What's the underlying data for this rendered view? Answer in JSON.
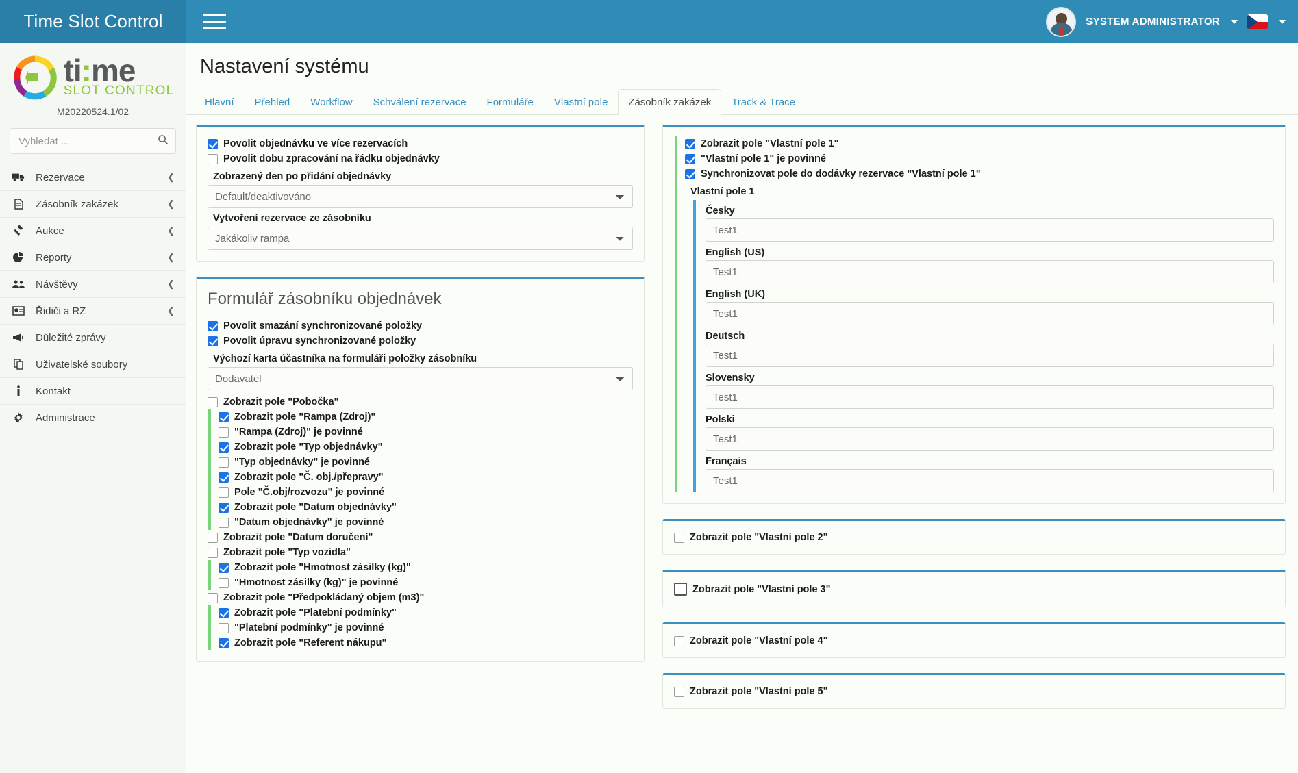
{
  "topbar": {
    "brand": "Time Slot Control",
    "menu_icon": "hamburger-icon",
    "user_name": "SYSTEM ADMINISTRATOR",
    "language_flag": "czech-flag"
  },
  "sidebar": {
    "logo_main": "ti",
    "logo_colon": ":",
    "logo_end": "me",
    "logo_sub": "SLOT CONTROL",
    "version": "M20220524.1/02",
    "search_placeholder": "Vyhledat ...",
    "items": [
      {
        "label": "Rezervace",
        "icon": "truck-icon"
      },
      {
        "label": "Zásobník zakázek",
        "icon": "clipboard-icon"
      },
      {
        "label": "Aukce",
        "icon": "gavel-icon"
      },
      {
        "label": "Reporty",
        "icon": "pie-chart-icon"
      },
      {
        "label": "Návštěvy",
        "icon": "users-icon"
      },
      {
        "label": "Řidiči a RZ",
        "icon": "id-card-icon"
      },
      {
        "label": "Důležité zprávy",
        "icon": "megaphone-icon"
      },
      {
        "label": "Uživatelské soubory",
        "icon": "copy-icon"
      },
      {
        "label": "Kontakt",
        "icon": "info-icon"
      },
      {
        "label": "Administrace",
        "icon": "gear-icon"
      }
    ]
  },
  "page": {
    "title": "Nastavení systému",
    "tabs": [
      {
        "label": "Hlavní",
        "active": false
      },
      {
        "label": "Přehled",
        "active": false
      },
      {
        "label": "Workflow",
        "active": false
      },
      {
        "label": "Schválení rezervace",
        "active": false
      },
      {
        "label": "Formuláře",
        "active": false
      },
      {
        "label": "Vlastní pole",
        "active": false
      },
      {
        "label": "Zásobník zakázek",
        "active": true
      },
      {
        "label": "Track & Trace",
        "active": false
      }
    ]
  },
  "left_card_1": {
    "checkboxes": [
      {
        "label": "Povolit objednávku ve více rezervacích",
        "checked": true
      },
      {
        "label": "Povolit dobu zpracování na řádku objednávky",
        "checked": false
      }
    ],
    "field1_label": "Zobrazený den po přidání objednávky",
    "field1_value": "Default/deaktivováno",
    "field2_label": "Vytvoření rezervace ze zásobníku",
    "field2_value": "Jakákoliv rampa"
  },
  "left_card_2": {
    "title": "Formulář zásobníku objednávek",
    "checkboxes_top": [
      {
        "label": "Povolit smazání synchronizované položky",
        "checked": true
      },
      {
        "label": "Povolit úpravu synchronizované položky",
        "checked": true
      }
    ],
    "field_label": "Výchozí karta účastníka na formuláři položky zásobníku",
    "field_value": "Dodavatel",
    "field_list": [
      {
        "label": "Zobrazit pole \"Pobočka\"",
        "checked": false,
        "indent": false
      },
      {
        "label": "Zobrazit pole \"Rampa (Zdroj)\"",
        "checked": true,
        "indent": true
      },
      {
        "label": "\"Rampa (Zdroj)\" je povinné",
        "checked": false,
        "indent": true
      },
      {
        "label": "Zobrazit pole \"Typ objednávky\"",
        "checked": true,
        "indent": true
      },
      {
        "label": "\"Typ objednávky\" je povinné",
        "checked": false,
        "indent": true
      },
      {
        "label": "Zobrazit pole \"Č. obj./přepravy\"",
        "checked": true,
        "indent": true
      },
      {
        "label": "Pole \"Č.obj/rozvozu\" je povinné",
        "checked": false,
        "indent": true
      },
      {
        "label": "Zobrazit pole \"Datum objednávky\"",
        "checked": true,
        "indent": true
      },
      {
        "label": "\"Datum objednávky\" je povinné",
        "checked": false,
        "indent": true
      },
      {
        "label": "Zobrazit pole \"Datum doručení\"",
        "checked": false,
        "indent": false
      },
      {
        "label": "Zobrazit pole \"Typ vozidla\"",
        "checked": false,
        "indent": false
      },
      {
        "label": "Zobrazit pole \"Hmotnost zásilky (kg)\"",
        "checked": true,
        "indent": true
      },
      {
        "label": "\"Hmotnost zásilky (kg)\" je povinné",
        "checked": false,
        "indent": true
      },
      {
        "label": "Zobrazit pole \"Předpokládaný objem (m3)\"",
        "checked": false,
        "indent": false
      },
      {
        "label": "Zobrazit pole \"Platební podmínky\"",
        "checked": true,
        "indent": true
      },
      {
        "label": "\"Platební podmínky\" je povinné",
        "checked": false,
        "indent": true
      },
      {
        "label": "Zobrazit pole \"Referent nákupu\"",
        "checked": true,
        "indent": true
      }
    ]
  },
  "right_card_1": {
    "checkboxes": [
      {
        "label": "Zobrazit pole \"Vlastní pole 1\"",
        "checked": true
      },
      {
        "label": "\"Vlastní pole 1\" je povinné",
        "checked": true
      },
      {
        "label": "Synchronizovat pole do dodávky rezervace \"Vlastní pole 1\"",
        "checked": true
      }
    ],
    "group_label": "Vlastní pole 1",
    "languages": [
      {
        "label": "Česky",
        "value": "Test1"
      },
      {
        "label": "English (US)",
        "value": "Test1"
      },
      {
        "label": "English (UK)",
        "value": "Test1"
      },
      {
        "label": "Deutsch",
        "value": "Test1"
      },
      {
        "label": "Slovensky",
        "value": "Test1"
      },
      {
        "label": "Polski",
        "value": "Test1"
      },
      {
        "label": "Français",
        "value": "Test1"
      }
    ]
  },
  "right_cards": [
    {
      "label": "Zobrazit pole \"Vlastní pole 2\"",
      "checked": false,
      "focused": false
    },
    {
      "label": "Zobrazit pole \"Vlastní pole 3\"",
      "checked": false,
      "focused": true
    },
    {
      "label": "Zobrazit pole \"Vlastní pole 4\"",
      "checked": false,
      "focused": false
    },
    {
      "label": "Zobrazit pole \"Vlastní pole 5\"",
      "checked": false,
      "focused": false
    }
  ],
  "colors": {
    "brand_dark": "#2a7fa8",
    "brand": "#2f8cb7",
    "accent_blue": "#3a8fc0",
    "check_blue": "#1a73e8",
    "green_marker": "#78d37a",
    "blue_marker": "#3aa5e0",
    "logo_green": "#8dc63f"
  }
}
